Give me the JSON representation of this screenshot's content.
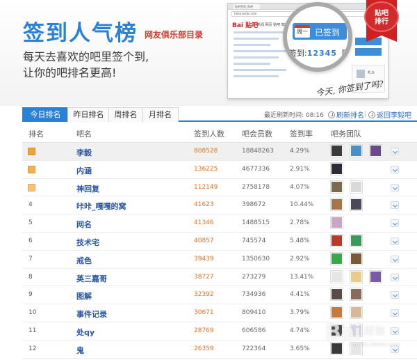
{
  "banner": {
    "title": "签到人气榜",
    "subtitle": "网友俱乐部目录",
    "desc_line1": "每天去喜欢的吧里签个到,",
    "desc_line2": "让你的吧排名更高!",
    "browser_tab": "贴吧签到_贴吧",
    "browser_url": "tieba.baidu.com",
    "browser_logo_main": "Bai",
    "browser_logo_accent": "贴吧",
    "browser_nav": "新闻  网页  贴吧  知道  音乐  图片  视频  地图",
    "sign_button": "已签到",
    "calendar_label": "周一",
    "signin_count_prefix": "签到:",
    "signin_count": "12345",
    "signin_count_suffix": "目录",
    "ribbon_line1": "贴吧",
    "ribbon_line2": "排行",
    "handwriting": "今天, 你签到了吗?",
    "sidebar_name": "吧_友"
  },
  "tabs": [
    {
      "label": "今日排名",
      "active": true
    },
    {
      "label": "昨日排名",
      "active": false
    },
    {
      "label": "周排名",
      "active": false
    },
    {
      "label": "月排名",
      "active": false
    }
  ],
  "refresh": {
    "time_label": "最近刷新时间: 08:16",
    "refresh_button": "刷新排名",
    "back_button": "返回李毅吧"
  },
  "columns": {
    "rank": "排名",
    "name": "吧名",
    "signins": "签到人数",
    "members": "吧会员数",
    "rate": "签到率",
    "team": "吧务团队"
  },
  "rows": [
    {
      "rank": "1",
      "name": "李毅",
      "signins": "808528",
      "members": "18848263",
      "rate": "4.29%",
      "medal": "#f0a23a",
      "avatars": [
        "#3b3b3b",
        "#4a90c8",
        "#6a4a8a"
      ]
    },
    {
      "rank": "2",
      "name": "内涵",
      "signins": "136225",
      "members": "4677336",
      "rate": "2.91%",
      "medal": "#f3b04e",
      "avatars": [
        "#2d2d3a"
      ]
    },
    {
      "rank": "3",
      "name": "神回复",
      "signins": "112149",
      "members": "2758178",
      "rate": "4.07%",
      "medal": "#f6c27a",
      "avatars": [
        "#7a6a52",
        "#d9d9d9"
      ]
    },
    {
      "rank": "4",
      "name": "咔咔_嘎嘎的窝",
      "signins": "41623",
      "members": "398672",
      "rate": "10.44%",
      "medal": "",
      "avatars": [
        "#a8744a",
        "#4a4a5a"
      ]
    },
    {
      "rank": "5",
      "name": "网名",
      "signins": "41346",
      "members": "1488515",
      "rate": "2.78%",
      "medal": "",
      "avatars": [
        "#c9a6c6"
      ]
    },
    {
      "rank": "6",
      "name": "技术宅",
      "signins": "40857",
      "members": "745574",
      "rate": "5.48%",
      "medal": "",
      "avatars": [
        "#b83a2a",
        "#3a9a5a"
      ]
    },
    {
      "rank": "7",
      "name": "戒色",
      "signins": "39439",
      "members": "1350630",
      "rate": "2.92%",
      "medal": "",
      "avatars": [
        "#3aa84a",
        "#7a5a3a"
      ]
    },
    {
      "rank": "8",
      "name": "英三嘉哥",
      "signins": "38727",
      "members": "273279",
      "rate": "13.41%",
      "medal": "",
      "avatars": [
        "#e6e6e6",
        "#eacb8a",
        "#7a5aa8"
      ]
    },
    {
      "rank": "9",
      "name": "图解",
      "signins": "32392",
      "members": "734936",
      "rate": "4.41%",
      "medal": "",
      "avatars": [
        "#5a4a4a",
        "#8a6a5a"
      ]
    },
    {
      "rank": "10",
      "name": "事件记录",
      "signins": "30671",
      "members": "809410",
      "rate": "3.79%",
      "medal": "",
      "avatars": [
        "#c87a3a",
        "#d9b89a"
      ]
    },
    {
      "rank": "11",
      "name": "处qy",
      "signins": "28769",
      "members": "606586",
      "rate": "4.74%",
      "medal": "",
      "avatars": [
        "#4a4a4a",
        "#d6d6e6"
      ]
    },
    {
      "rank": "12",
      "name": "鬼",
      "signins": "26359",
      "members": "722364",
      "rate": "3.65%",
      "medal": "",
      "avatars": [
        "#3a3a3a",
        "#e6e6e6"
      ]
    }
  ],
  "watermark": {
    "main": "Bai",
    "sub": "经验",
    "url": "jingyan.baidu.com"
  },
  "colors": {
    "accent": "#2a82d6",
    "signins": "#e8701c",
    "link": "#2a55a8"
  }
}
